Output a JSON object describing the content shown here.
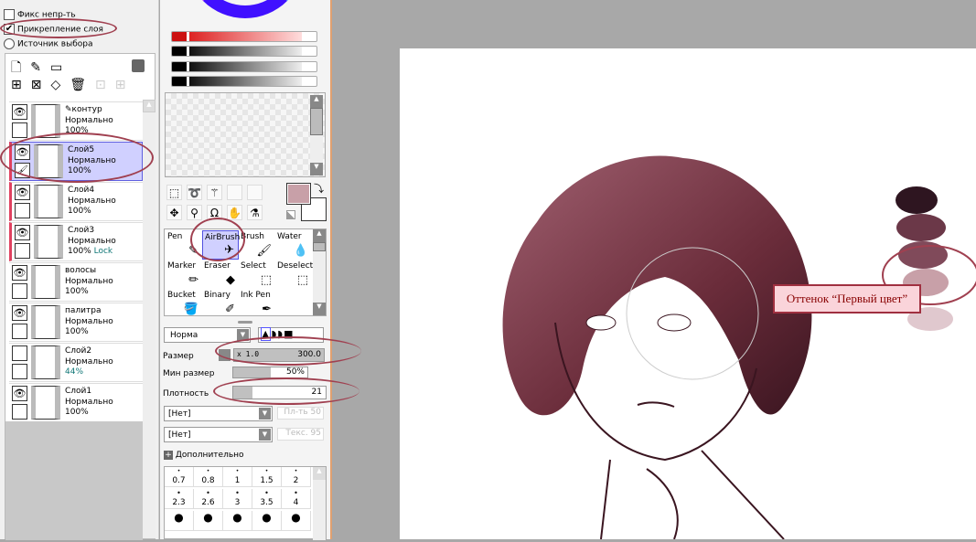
{
  "options": {
    "fix_opacity": "Фикс непр-ть",
    "clip_layer": "Прикрепление слоя",
    "clip_checked": true,
    "selection_source": "Источник выбора"
  },
  "layers": [
    {
      "name": "контур",
      "mode": "Нормально",
      "opacity": "100%",
      "visible": true,
      "icon": "pen-icon"
    },
    {
      "name": "Слой5",
      "mode": "Нормально",
      "opacity": "100%",
      "visible": true,
      "selected": true,
      "clipped": true
    },
    {
      "name": "Слой4",
      "mode": "Нормально",
      "opacity": "100%",
      "visible": true,
      "clipped": true
    },
    {
      "name": "Слой3",
      "mode": "Нормально",
      "opacity": "100%",
      "lock": "Lock",
      "visible": true,
      "clipped": true
    },
    {
      "name": "волосы",
      "mode": "Нормально",
      "opacity": "100%",
      "visible": true
    },
    {
      "name": "палитра",
      "mode": "Нормально",
      "opacity": "100%",
      "visible": true
    },
    {
      "name": "Слой2",
      "mode": "Нормально",
      "opacity": "44%",
      "visible": false
    },
    {
      "name": "Слой1",
      "mode": "Нормально",
      "opacity": "100%",
      "visible": true
    }
  ],
  "tools": [
    {
      "label": "Pen",
      "icon": "pen-icon"
    },
    {
      "label": "AirBrush",
      "icon": "airbrush-icon",
      "selected": true
    },
    {
      "label": "Brush",
      "icon": "brush-icon"
    },
    {
      "label": "Water",
      "icon": "water-icon"
    },
    {
      "label": "Marker",
      "icon": "marker-icon"
    },
    {
      "label": "Eraser",
      "icon": "eraser-icon"
    },
    {
      "label": "Select",
      "icon": "select-icon"
    },
    {
      "label": "Deselect",
      "icon": "deselect-icon"
    },
    {
      "label": "Bucket",
      "icon": "bucket-icon"
    },
    {
      "label": "Binary",
      "icon": "binary-icon"
    },
    {
      "label": "Ink Pen",
      "icon": "ink-pen-icon"
    }
  ],
  "brush": {
    "mode": "Норма",
    "size_label": "Размер",
    "size_mult": "x 1.0",
    "size_value": "300.0",
    "min_size_label": "Мин размер",
    "min_size_value": "50%",
    "min_size_fraction": 0.5,
    "density_label": "Плотность",
    "density_value": "21",
    "density_fraction": 0.21,
    "texture1": "[Нет]",
    "texture2": "[Нет]",
    "blend_label": "Пл-ть 50",
    "texture_label": "Текс. 95",
    "advanced": "Дополнительно",
    "sizes": [
      "0.7",
      "0.8",
      "1",
      "1.5",
      "2",
      "2.3",
      "2.6",
      "3",
      "3.5",
      "4"
    ]
  },
  "colors": {
    "primary": "#c8a0a8",
    "secondary": "#ffffff",
    "slider_red": "#cc1111",
    "hair": "#7a3a48"
  },
  "annotation": "Оттенок “Первый цвет”"
}
